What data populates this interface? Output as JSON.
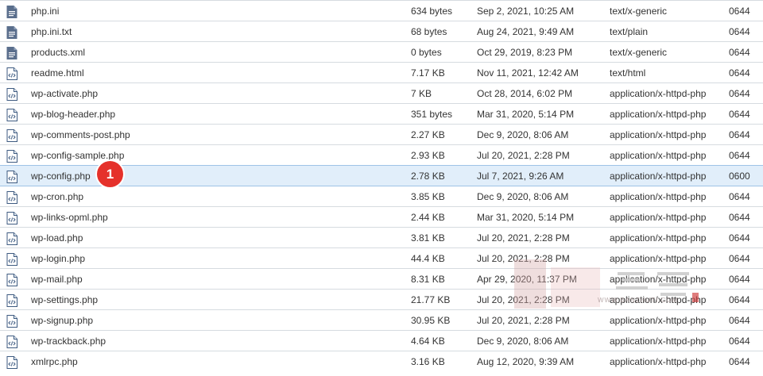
{
  "files": [
    {
      "name": "php.ini",
      "size": "634 bytes",
      "modified": "Sep 2, 2021, 10:25 AM",
      "type": "text/x-generic",
      "perms": "0644",
      "icon": "file-text-icon"
    },
    {
      "name": "php.ini.txt",
      "size": "68 bytes",
      "modified": "Aug 24, 2021, 9:49 AM",
      "type": "text/plain",
      "perms": "0644",
      "icon": "file-text-icon"
    },
    {
      "name": "products.xml",
      "size": "0 bytes",
      "modified": "Oct 29, 2019, 8:23 PM",
      "type": "text/x-generic",
      "perms": "0644",
      "icon": "file-text-icon"
    },
    {
      "name": "readme.html",
      "size": "7.17 KB",
      "modified": "Nov 11, 2021, 12:42 AM",
      "type": "text/html",
      "perms": "0644",
      "icon": "file-code-icon"
    },
    {
      "name": "wp-activate.php",
      "size": "7 KB",
      "modified": "Oct 28, 2014, 6:02 PM",
      "type": "application/x-httpd-php",
      "perms": "0644",
      "icon": "file-code-icon"
    },
    {
      "name": "wp-blog-header.php",
      "size": "351 bytes",
      "modified": "Mar 31, 2020, 5:14 PM",
      "type": "application/x-httpd-php",
      "perms": "0644",
      "icon": "file-code-icon"
    },
    {
      "name": "wp-comments-post.php",
      "size": "2.27 KB",
      "modified": "Dec 9, 2020, 8:06 AM",
      "type": "application/x-httpd-php",
      "perms": "0644",
      "icon": "file-code-icon"
    },
    {
      "name": "wp-config-sample.php",
      "size": "2.93 KB",
      "modified": "Jul 20, 2021, 2:28 PM",
      "type": "application/x-httpd-php",
      "perms": "0644",
      "icon": "file-code-icon"
    },
    {
      "name": "wp-config.php",
      "size": "2.78 KB",
      "modified": "Jul 7, 2021, 9:26 AM",
      "type": "application/x-httpd-php",
      "perms": "0600",
      "icon": "file-code-icon",
      "selected": true
    },
    {
      "name": "wp-cron.php",
      "size": "3.85 KB",
      "modified": "Dec 9, 2020, 8:06 AM",
      "type": "application/x-httpd-php",
      "perms": "0644",
      "icon": "file-code-icon"
    },
    {
      "name": "wp-links-opml.php",
      "size": "2.44 KB",
      "modified": "Mar 31, 2020, 5:14 PM",
      "type": "application/x-httpd-php",
      "perms": "0644",
      "icon": "file-code-icon"
    },
    {
      "name": "wp-load.php",
      "size": "3.81 KB",
      "modified": "Jul 20, 2021, 2:28 PM",
      "type": "application/x-httpd-php",
      "perms": "0644",
      "icon": "file-code-icon"
    },
    {
      "name": "wp-login.php",
      "size": "44.4 KB",
      "modified": "Jul 20, 2021, 2:28 PM",
      "type": "application/x-httpd-php",
      "perms": "0644",
      "icon": "file-code-icon"
    },
    {
      "name": "wp-mail.php",
      "size": "8.31 KB",
      "modified": "Apr 29, 2020, 11:37 PM",
      "type": "application/x-httpd-php",
      "perms": "0644",
      "icon": "file-code-icon"
    },
    {
      "name": "wp-settings.php",
      "size": "21.77 KB",
      "modified": "Jul 20, 2021, 2:28 PM",
      "type": "application/x-httpd-php",
      "perms": "0644",
      "icon": "file-code-icon"
    },
    {
      "name": "wp-signup.php",
      "size": "30.95 KB",
      "modified": "Jul 20, 2021, 2:28 PM",
      "type": "application/x-httpd-php",
      "perms": "0644",
      "icon": "file-code-icon"
    },
    {
      "name": "wp-trackback.php",
      "size": "4.64 KB",
      "modified": "Dec 9, 2020, 8:06 AM",
      "type": "application/x-httpd-php",
      "perms": "0644",
      "icon": "file-code-icon"
    },
    {
      "name": "xmlrpc.php",
      "size": "3.16 KB",
      "modified": "Aug 12, 2020, 9:39 AM",
      "type": "application/x-httpd-php",
      "perms": "0644",
      "icon": "file-code-icon"
    }
  ],
  "annotation": {
    "marker_label": "1"
  },
  "watermark": {
    "text": "WWW.BANZHUTI.COM"
  },
  "colors": {
    "selected_row": "#e1eefa",
    "icon": "#3d5a80",
    "marker": "#e5312b"
  }
}
